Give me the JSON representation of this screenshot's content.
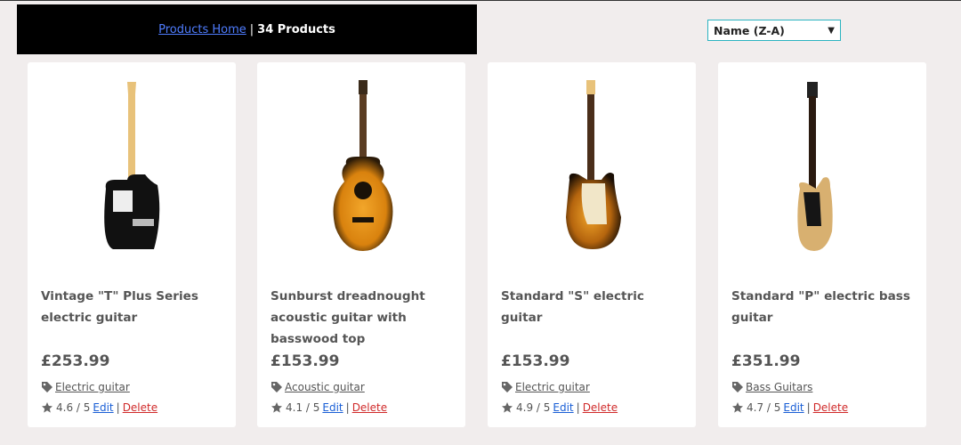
{
  "header": {
    "home_link": "Products Home",
    "separator": "|",
    "count_text": "34 Products"
  },
  "sort": {
    "selected": "Name (Z-A)"
  },
  "actions": {
    "edit": "Edit",
    "delete": "Delete",
    "separator": "|"
  },
  "products": [
    {
      "title": "Vintage \"T\" Plus Series electric guitar",
      "price": "£253.99",
      "category": "Electric guitar",
      "rating": "4.6 / 5"
    },
    {
      "title": "Sunburst dreadnought acoustic guitar with basswood top",
      "price": "£153.99",
      "category": "Acoustic guitar",
      "rating": "4.1 / 5"
    },
    {
      "title": "Standard \"S\" electric guitar",
      "price": "£153.99",
      "category": "Electric guitar",
      "rating": "4.9 / 5"
    },
    {
      "title": "Standard \"P\" electric bass guitar",
      "price": "£351.99",
      "category": "Bass Guitars",
      "rating": "4.7 / 5"
    }
  ]
}
